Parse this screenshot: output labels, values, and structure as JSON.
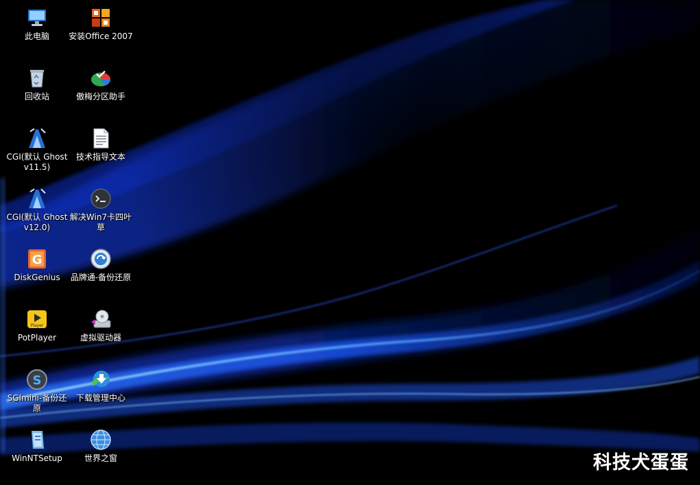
{
  "desktop_icons": [
    {
      "label": "此电脑",
      "icon": "computer-icon"
    },
    {
      "label": "安装Office 2007",
      "icon": "office-icon"
    },
    {
      "label": "回收站",
      "icon": "recycle-bin-icon"
    },
    {
      "label": "傲梅分区助手",
      "icon": "partition-assistant-icon"
    },
    {
      "label": "CGI(默认 Ghost v11.5)",
      "icon": "cgi-ghost-icon"
    },
    {
      "label": "技术指导文本",
      "icon": "text-document-icon"
    },
    {
      "label": "CGI(默认 Ghost v12.0)",
      "icon": "cgi-ghost-icon"
    },
    {
      "label": "解决Win7卡四叶草",
      "icon": "terminal-icon"
    },
    {
      "label": "DiskGenius",
      "icon": "diskgenius-icon"
    },
    {
      "label": "品牌通-备份还原",
      "icon": "backup-restore-icon"
    },
    {
      "label": "PotPlayer",
      "icon": "potplayer-icon"
    },
    {
      "label": "虚拟驱动器",
      "icon": "virtual-drive-icon"
    },
    {
      "label": "SGImini-备份还原",
      "icon": "sgimini-icon"
    },
    {
      "label": "下载管理中心",
      "icon": "download-manager-icon"
    },
    {
      "label": "WinNTSetup",
      "icon": "winntsetup-icon"
    },
    {
      "label": "世界之窗",
      "icon": "browser-globe-icon"
    }
  ],
  "watermark": "科技犬蛋蛋",
  "colors": {
    "background": "#000000",
    "wave_blue": "#1e5bff",
    "wave_light": "#8fd0ff"
  }
}
